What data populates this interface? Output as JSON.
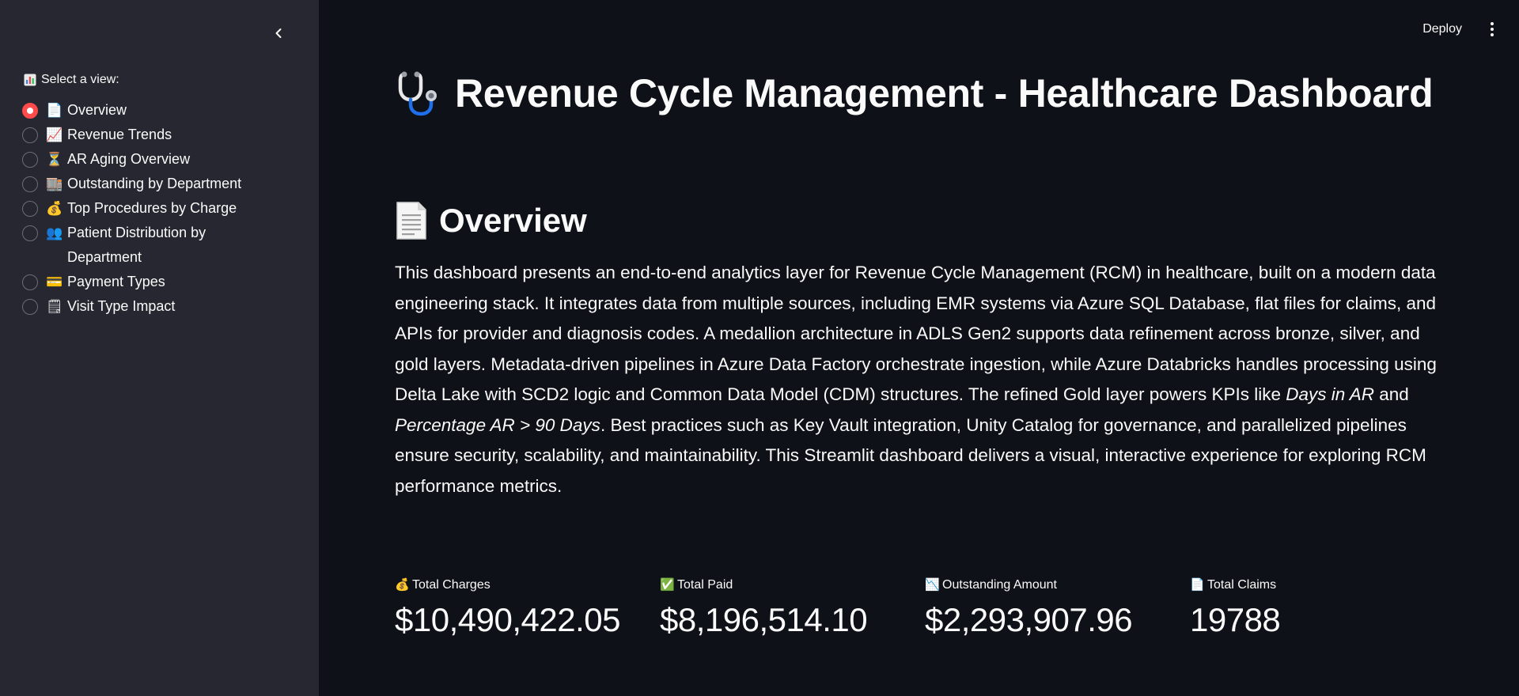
{
  "sidebar": {
    "select_label": "Select a view:",
    "select_icon": "bar-chart-icon",
    "options": [
      {
        "emoji": "📄",
        "label": "Overview",
        "selected": true
      },
      {
        "emoji": "📈",
        "label": "Revenue Trends",
        "selected": false
      },
      {
        "emoji": "⏳",
        "label": "AR Aging Overview",
        "selected": false
      },
      {
        "emoji": "🏬",
        "label": "Outstanding by Department",
        "selected": false
      },
      {
        "emoji": "💰",
        "label": "Top Procedures by Charge",
        "selected": false
      },
      {
        "emoji": "👥",
        "label": "Patient Distribution by Department",
        "selected": false
      },
      {
        "emoji": "💳",
        "label": "Payment Types",
        "selected": false
      },
      {
        "emoji": "🗒",
        "label": "Visit Type Impact",
        "selected": false
      }
    ]
  },
  "toolbar": {
    "deploy_label": "Deploy"
  },
  "header": {
    "title": "Revenue Cycle Management - Healthcare Dashboard",
    "title_icon": "stethoscope-icon"
  },
  "overview": {
    "heading": "Overview",
    "heading_icon": "document-icon",
    "description_parts": {
      "p1": "This dashboard presents an end-to-end analytics layer for Revenue Cycle Management (RCM) in healthcare, built on a modern data engineering stack. It integrates data from multiple sources, including EMR systems via Azure SQL Database, flat files for claims, and APIs for provider and diagnosis codes. A medallion architecture in ADLS Gen2 supports data refinement across bronze, silver, and gold layers. Metadata-driven pipelines in Azure Data Factory orchestrate ingestion, while Azure Databricks handles processing using Delta Lake with SCD2 logic and Common Data Model (CDM) structures. The refined Gold layer powers KPIs like ",
      "em1": "Days in AR",
      "p2": " and ",
      "em2": "Percentage AR > 90 Days",
      "p3": ". Best practices such as Key Vault integration, Unity Catalog for governance, and parallelized pipelines ensure security, scalability, and maintainability. This Streamlit dashboard delivers a visual, interactive experience for exploring RCM performance metrics."
    }
  },
  "metrics": [
    {
      "emoji": "💰",
      "label": "Total Charges",
      "value": "$10,490,422.05"
    },
    {
      "emoji": "✅",
      "label": "Total Paid",
      "value": "$8,196,514.10"
    },
    {
      "emoji": "📉",
      "label": "Outstanding Amount",
      "value": "$2,293,907.96"
    },
    {
      "emoji": "📄",
      "label": "Total Claims",
      "value": "19788"
    }
  ],
  "colors": {
    "background": "#0e1117",
    "sidebar": "#262730",
    "accent": "#ff4b4b",
    "text": "#fafafa"
  }
}
